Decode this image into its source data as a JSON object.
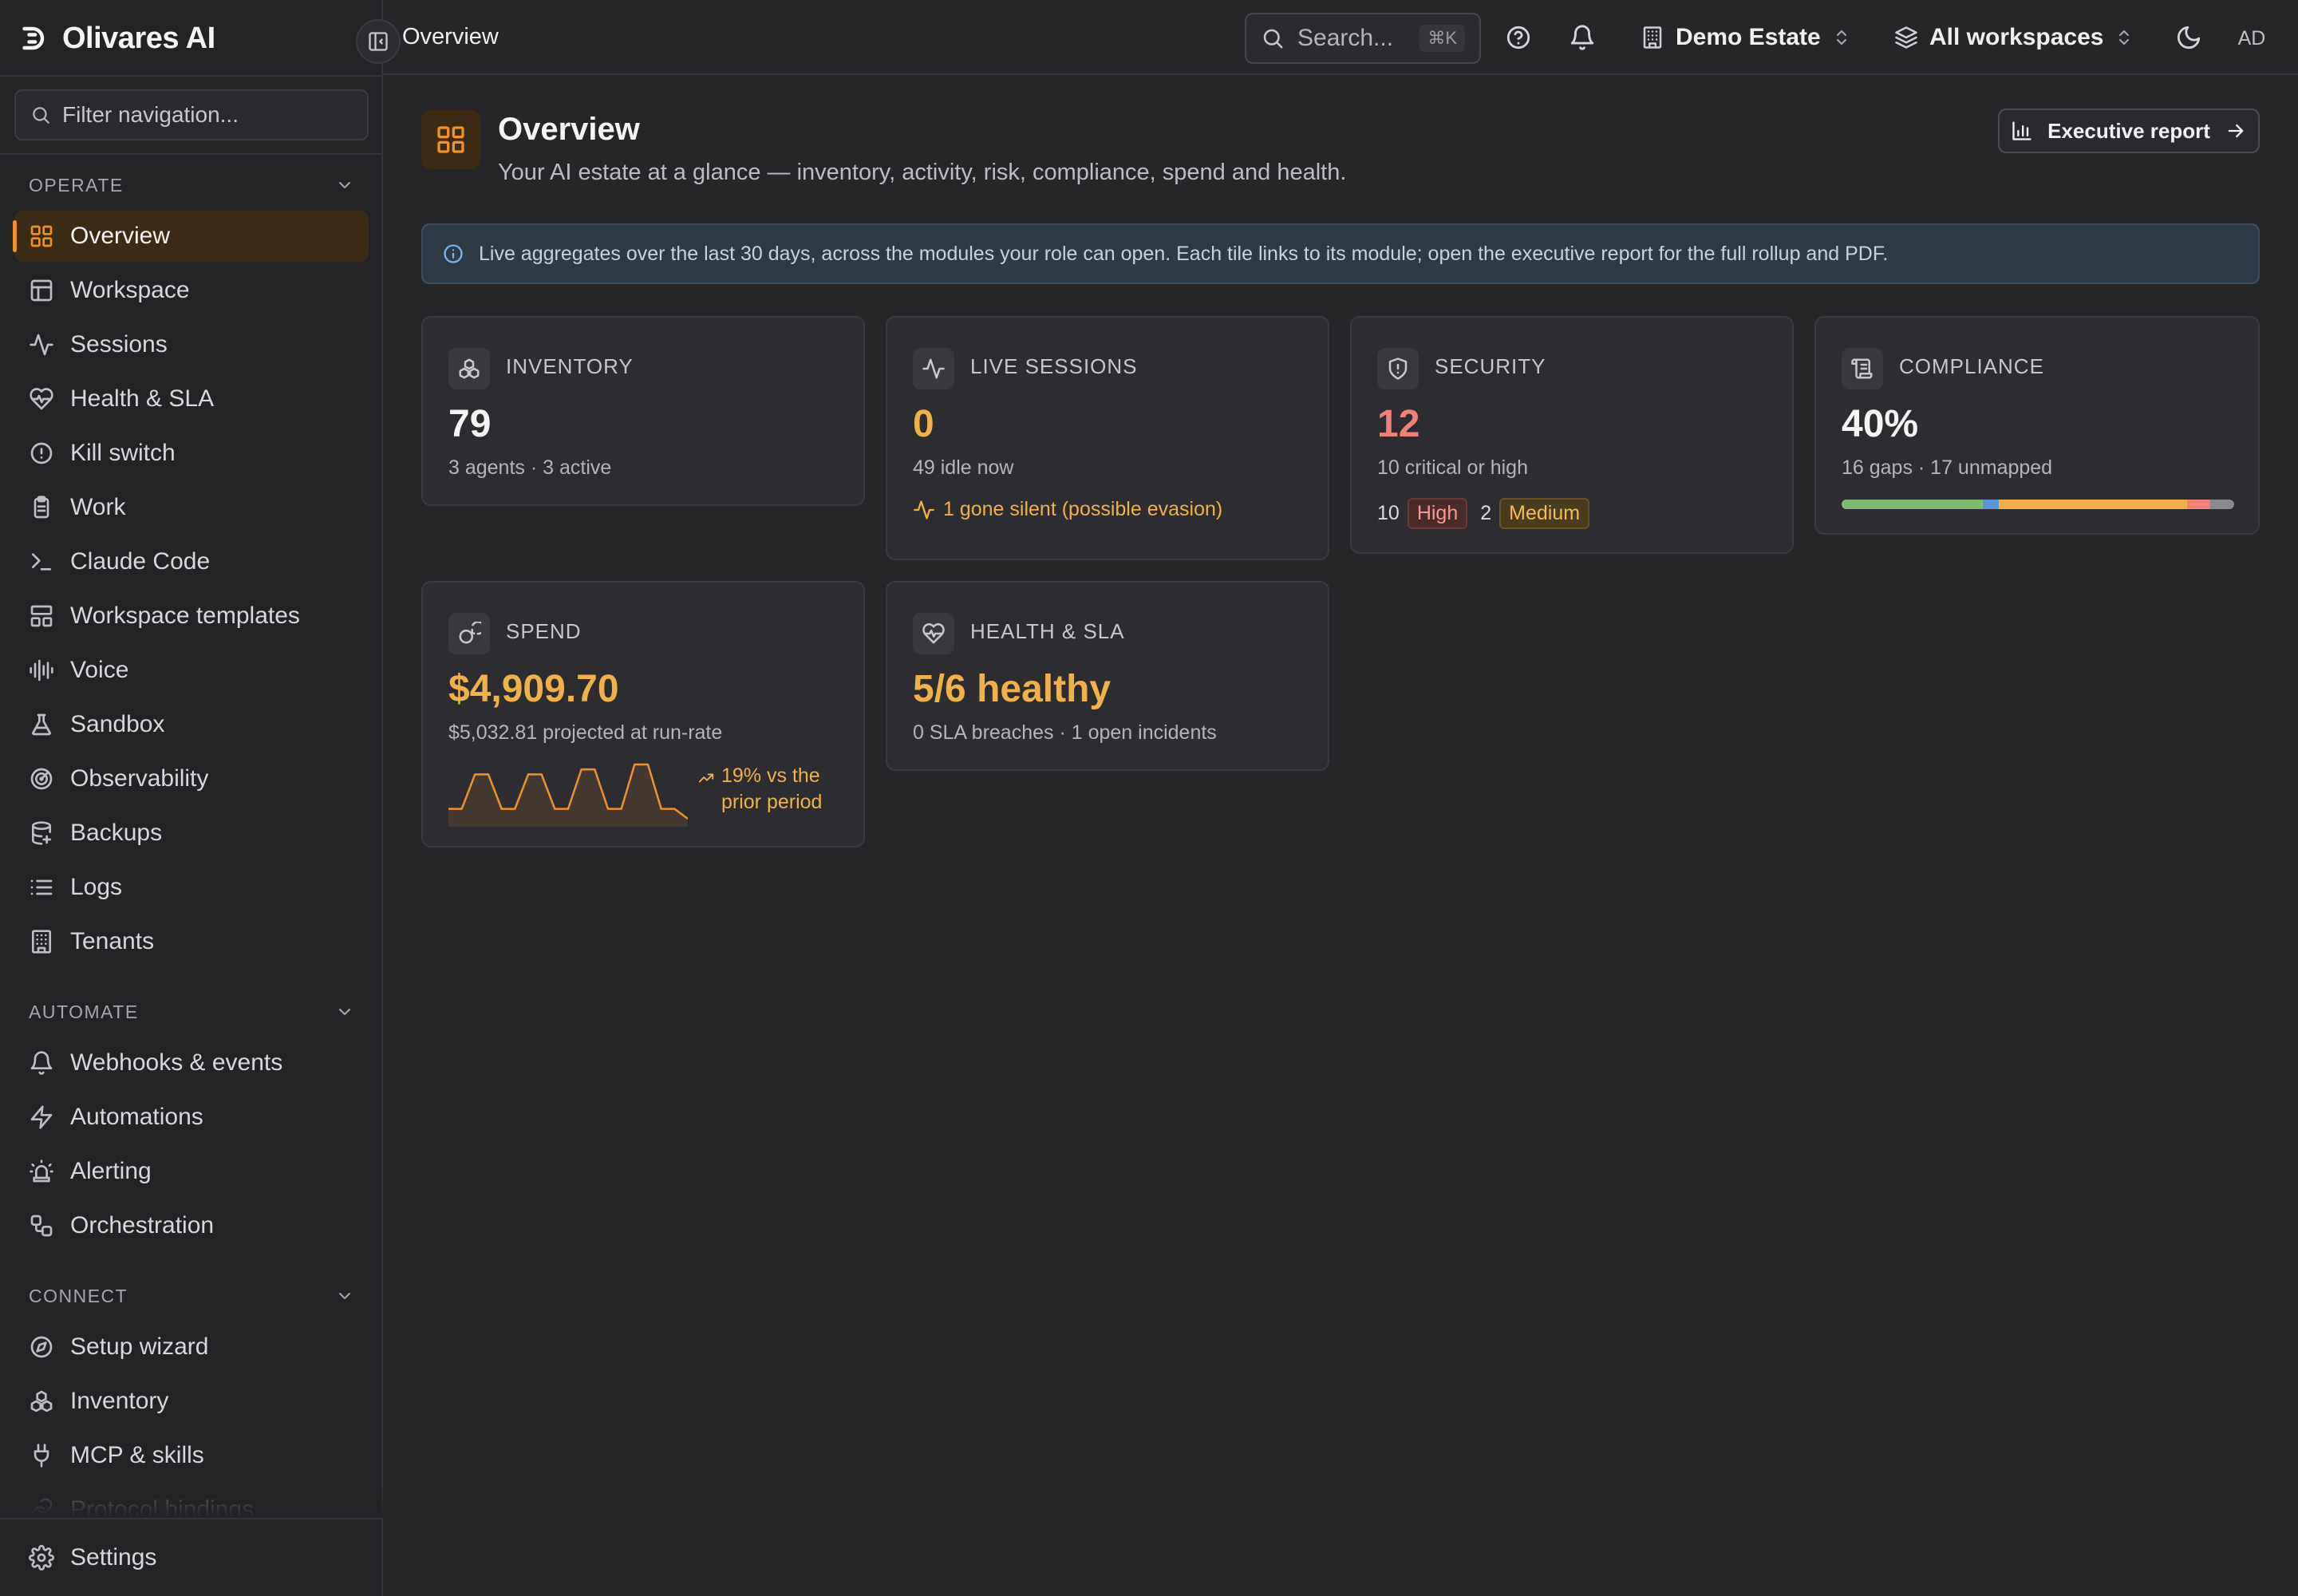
{
  "app": {
    "name": "Olivares AI"
  },
  "sidebar": {
    "filter_placeholder": "Filter navigation...",
    "sections": {
      "operate": "OPERATE",
      "automate": "AUTOMATE",
      "connect": "CONNECT"
    },
    "operate_items": [
      {
        "label": "Overview",
        "icon": "grid-icon",
        "active": true
      },
      {
        "label": "Workspace",
        "icon": "layout-icon"
      },
      {
        "label": "Sessions",
        "icon": "activity-icon"
      },
      {
        "label": "Health & SLA",
        "icon": "heart-pulse-icon"
      },
      {
        "label": "Kill switch",
        "icon": "alert-circle-icon"
      },
      {
        "label": "Work",
        "icon": "clipboard-icon"
      },
      {
        "label": "Claude Code",
        "icon": "terminal-icon"
      },
      {
        "label": "Workspace templates",
        "icon": "template-icon"
      },
      {
        "label": "Voice",
        "icon": "waveform-icon"
      },
      {
        "label": "Sandbox",
        "icon": "flask-icon"
      },
      {
        "label": "Observability",
        "icon": "radar-icon"
      },
      {
        "label": "Backups",
        "icon": "database-icon"
      },
      {
        "label": "Logs",
        "icon": "list-icon"
      },
      {
        "label": "Tenants",
        "icon": "building-icon"
      }
    ],
    "automate_items": [
      {
        "label": "Webhooks & events",
        "icon": "bell-icon"
      },
      {
        "label": "Automations",
        "icon": "zap-icon"
      },
      {
        "label": "Alerting",
        "icon": "siren-icon"
      },
      {
        "label": "Orchestration",
        "icon": "workflow-icon"
      }
    ],
    "connect_items": [
      {
        "label": "Setup wizard",
        "icon": "compass-icon"
      },
      {
        "label": "Inventory",
        "icon": "boxes-icon"
      },
      {
        "label": "MCP & skills",
        "icon": "plug-icon"
      },
      {
        "label": "Protocol bindings",
        "icon": "link-icon"
      }
    ],
    "settings_label": "Settings"
  },
  "header": {
    "breadcrumb": "Overview",
    "search_placeholder": "Search...",
    "search_shortcut": "⌘K",
    "estate": "Demo Estate",
    "workspace": "All workspaces",
    "avatar_initials": "AD"
  },
  "page": {
    "title": "Overview",
    "subtitle": "Your AI estate at a glance — inventory, activity, risk, compliance, spend and health.",
    "exec_report_label": "Executive report",
    "info_banner": "Live aggregates over the last 30 days, across the modules your role can open. Each tile links to its module; open the executive report for the full rollup and PDF."
  },
  "cards": {
    "inventory": {
      "label": "INVENTORY",
      "value": "79",
      "detail": "3 agents · 3 active"
    },
    "sessions": {
      "label": "LIVE SESSIONS",
      "value": "0",
      "detail": "49 idle now",
      "note": "1 gone silent (possible evasion)"
    },
    "security": {
      "label": "SECURITY",
      "value": "12",
      "detail": "10 critical or high",
      "high_count": "10",
      "high_label": "High",
      "medium_count": "2",
      "medium_label": "Medium"
    },
    "compliance": {
      "label": "COMPLIANCE",
      "value": "40%",
      "detail": "16 gaps · 17 unmapped",
      "bar_segments": [
        {
          "fraction": 0.36,
          "color": "#7fba72"
        },
        {
          "fraction": 0.04,
          "color": "#5b93d6"
        },
        {
          "fraction": 0.48,
          "color": "#f0b04a"
        },
        {
          "fraction": 0.06,
          "color": "#f08078"
        },
        {
          "fraction": 0.06,
          "color": "#8a8a92"
        }
      ]
    },
    "spend": {
      "label": "SPEND",
      "value": "$4,909.70",
      "detail": "$5,032.81 projected at run-rate",
      "trend": "19% vs the prior period",
      "sparkline": [
        2,
        2,
        9,
        9,
        2,
        2,
        9,
        9,
        2,
        2,
        10,
        10,
        2,
        2,
        11,
        11,
        2,
        2,
        0
      ]
    },
    "health": {
      "label": "HEALTH & SLA",
      "value": "5/6 healthy",
      "detail": "0 SLA breaches · 1 open incidents"
    }
  },
  "colors": {
    "accent": "#f0902a",
    "amber": "#f0b04a",
    "danger": "#f08078",
    "info": "#7fb1e6"
  }
}
